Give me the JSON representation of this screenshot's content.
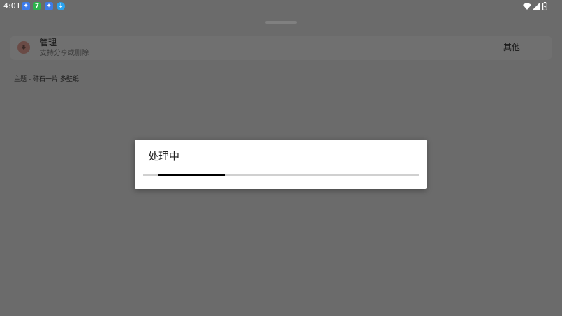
{
  "status_bar": {
    "time": "4:01",
    "notification_icons": [
      {
        "name": "bird-app-icon",
        "color": "#3d7be8",
        "glyph": "✦"
      },
      {
        "name": "seven-app-icon",
        "color": "#2fb24c",
        "glyph": "7"
      },
      {
        "name": "bird-app-icon-2",
        "color": "#3d7be8",
        "glyph": "✦"
      },
      {
        "name": "download-app-icon",
        "color": "#2aa3f0",
        "glyph": "↓"
      }
    ],
    "system_icons": [
      "wifi-icon",
      "cell-signal-icon",
      "battery-icon"
    ]
  },
  "settings_row": {
    "title": "管理",
    "subtitle": "支持分享或删除",
    "action_label": "其他",
    "icon": "download-icon",
    "icon_color": "#6a4b46"
  },
  "caption": {
    "text": "主题 - 碎石一片   多壁纸"
  },
  "dialog": {
    "title": "处理中",
    "progress": {
      "start_fraction": 0.055,
      "end_fraction": 0.3
    }
  },
  "colors": {
    "scrim": "#6b6b6b",
    "dialog_background": "#ffffff",
    "progress_indicator": "#000000",
    "progress_track": "#d0d0d0"
  }
}
